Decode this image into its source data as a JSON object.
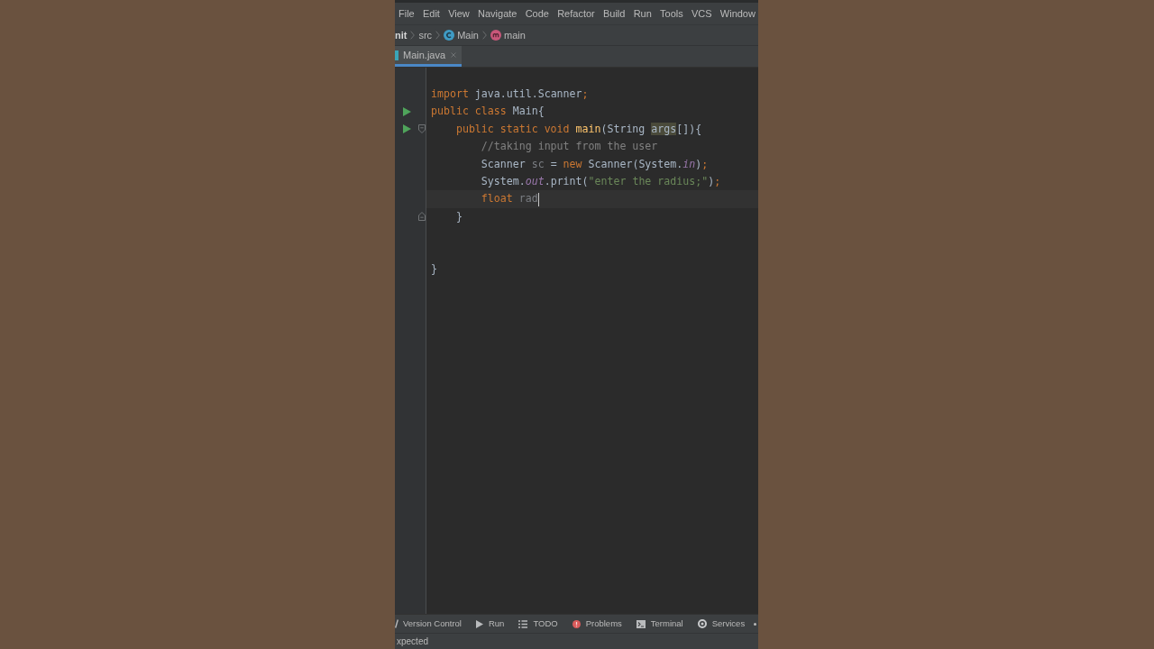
{
  "menu_bar": {
    "items": [
      "File",
      "Edit",
      "View",
      "Navigate",
      "Code",
      "Refactor",
      "Build",
      "Run",
      "Tools",
      "VCS",
      "Window"
    ]
  },
  "breadcrumbs": [
    {
      "label": "nit",
      "kind": "module"
    },
    {
      "label": "src",
      "kind": "folder"
    },
    {
      "label": "Main",
      "kind": "class"
    },
    {
      "label": "main",
      "kind": "method"
    }
  ],
  "tabs": [
    {
      "label": "Main.java",
      "selected": true
    }
  ],
  "editor": {
    "lines": [
      {
        "kind": "code",
        "run_marker": false,
        "fold_start": false,
        "fold_end": false,
        "current": false,
        "tokens": [
          {
            "text": "import",
            "kind": "keyword"
          },
          {
            "text": " java.util.Scanner",
            "kind": "plain"
          },
          {
            "text": ";",
            "kind": "semicolon"
          }
        ]
      },
      {
        "kind": "code",
        "run_marker": true,
        "fold_start": false,
        "fold_end": false,
        "current": false,
        "tokens": [
          {
            "text": "public class",
            "kind": "keyword"
          },
          {
            "text": " Main{",
            "kind": "plain"
          }
        ]
      },
      {
        "kind": "code",
        "run_marker": true,
        "fold_start": true,
        "fold_end": false,
        "current": false,
        "tokens": [
          {
            "text": "    public static void ",
            "kind": "keyword"
          },
          {
            "text": "main",
            "kind": "method"
          },
          {
            "text": "(String ",
            "kind": "plain"
          },
          {
            "text": "args",
            "kind": "usage"
          },
          {
            "text": "[]){",
            "kind": "plain"
          }
        ]
      },
      {
        "kind": "code",
        "run_marker": false,
        "fold_start": false,
        "fold_end": false,
        "current": false,
        "tokens": [
          {
            "text": "        //taking input from the user",
            "kind": "comment"
          }
        ]
      },
      {
        "kind": "code",
        "run_marker": false,
        "fold_start": false,
        "fold_end": false,
        "current": false,
        "tokens": [
          {
            "text": "        Scanner ",
            "kind": "plain"
          },
          {
            "text": "sc",
            "kind": "unused"
          },
          {
            "text": " = ",
            "kind": "plain"
          },
          {
            "text": "new",
            "kind": "keyword"
          },
          {
            "text": " Scanner(System.",
            "kind": "plain"
          },
          {
            "text": "in",
            "kind": "field"
          },
          {
            "text": ")",
            "kind": "plain"
          },
          {
            "text": ";",
            "kind": "semicolon"
          }
        ]
      },
      {
        "kind": "code",
        "run_marker": false,
        "fold_start": false,
        "fold_end": false,
        "current": false,
        "tokens": [
          {
            "text": "        System.",
            "kind": "plain"
          },
          {
            "text": "out",
            "kind": "field"
          },
          {
            "text": ".print(",
            "kind": "plain"
          },
          {
            "text": "\"enter the radius;\"",
            "kind": "string"
          },
          {
            "text": ")",
            "kind": "plain"
          },
          {
            "text": ";",
            "kind": "semicolon"
          }
        ]
      },
      {
        "kind": "code",
        "run_marker": false,
        "fold_start": false,
        "fold_end": false,
        "current": true,
        "tokens": [
          {
            "text": "        float ",
            "kind": "keyword"
          },
          {
            "text": "rad",
            "kind": "unused"
          }
        ]
      },
      {
        "kind": "code",
        "run_marker": false,
        "fold_start": false,
        "fold_end": true,
        "current": false,
        "tokens": [
          {
            "text": "    }",
            "kind": "plain"
          }
        ]
      },
      {
        "kind": "blank",
        "run_marker": false,
        "fold_start": false,
        "fold_end": false,
        "current": false
      },
      {
        "kind": "blank",
        "run_marker": false,
        "fold_start": false,
        "fold_end": false,
        "current": false
      },
      {
        "kind": "code",
        "run_marker": false,
        "fold_start": false,
        "fold_end": false,
        "current": false,
        "tokens": [
          {
            "text": "}",
            "kind": "plain"
          }
        ]
      }
    ]
  },
  "tool_window_bar": {
    "items": [
      {
        "label": "Version Control",
        "kind": "vcs"
      },
      {
        "label": "Run",
        "kind": "run"
      },
      {
        "label": "TODO",
        "kind": "todo"
      },
      {
        "label": "Problems",
        "kind": "problems"
      },
      {
        "label": "Terminal",
        "kind": "terminal"
      },
      {
        "label": "Services",
        "kind": "services"
      }
    ]
  },
  "status_bar": {
    "message": "xpected"
  }
}
